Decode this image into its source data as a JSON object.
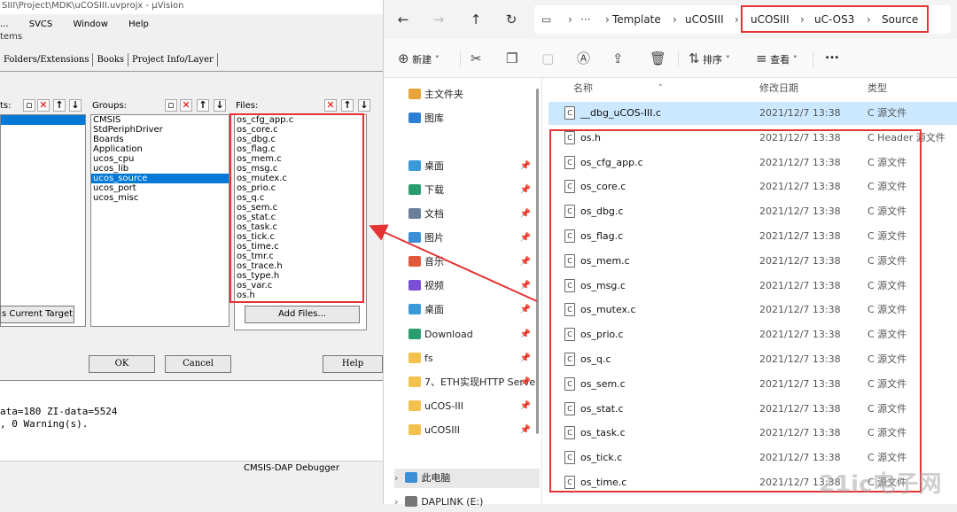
{
  "uvision": {
    "title": "SIII\\Project\\MDK\\uCOSIII.uvprojx - µVision",
    "menu": [
      "...",
      "SVCS",
      "Window",
      "Help"
    ],
    "dialog_title": "tems",
    "tabs": [
      "Folders/Extensions",
      "Books",
      "Project Info/Layer"
    ],
    "groups_label": "Groups:",
    "files_label": "Files:",
    "left_label": "ts:",
    "groups": [
      "CMSIS",
      "StdPeriphDriver",
      "Boards",
      "Application",
      "ucos_cpu",
      "ucos_lib",
      "ucos_source",
      "ucos_port",
      "ucos_misc"
    ],
    "selected_group": "ucos_source",
    "files": [
      "os_cfg_app.c",
      "os_core.c",
      "os_dbg.c",
      "os_flag.c",
      "os_mem.c",
      "os_msg.c",
      "os_mutex.c",
      "os_prio.c",
      "os_q.c",
      "os_sem.c",
      "os_stat.c",
      "os_task.c",
      "os_tick.c",
      "os_time.c",
      "os_tmr.c",
      "os_trace.h",
      "os_type.h",
      "os_var.c",
      "os.h"
    ],
    "set_target_button": "s Current Target",
    "add_files_button": "Add Files...",
    "ok_button": "OK",
    "cancel_button": "Cancel",
    "help_button": "Help",
    "build_output": [
      "ata=180 ZI-data=5524",
      ", 0 Warning(s)."
    ],
    "debugger": "CMSIS-DAP Debugger"
  },
  "explorer": {
    "breadcrumb": [
      "Template",
      "uCOSIII",
      "uCOSIII",
      "uC-OS3",
      "Source"
    ],
    "commands": {
      "new": "新建",
      "sort": "排序",
      "view": "查看",
      "more": "..."
    },
    "nav_items": [
      {
        "label": "主文件夹",
        "icon": "home-icon",
        "color": "#e8a33b"
      },
      {
        "label": "图库",
        "icon": "gallery-icon",
        "color": "#2c7fd1"
      },
      {
        "label": "桌面",
        "icon": "desktop-icon",
        "color": "#3a9ad9"
      },
      {
        "label": "下载",
        "icon": "download-icon",
        "color": "#2a9d6f"
      },
      {
        "label": "文档",
        "icon": "document-icon",
        "color": "#6a7f9a"
      },
      {
        "label": "图片",
        "icon": "picture-icon",
        "color": "#3a8fd6"
      },
      {
        "label": "音乐",
        "icon": "music-icon",
        "color": "#e05a3a"
      },
      {
        "label": "视频",
        "icon": "video-icon",
        "color": "#7b4fd6"
      },
      {
        "label": "桌面",
        "icon": "desktop-icon",
        "color": "#3a9ad9"
      },
      {
        "label": "Download",
        "icon": "download-icon",
        "color": "#2a9d6f"
      },
      {
        "label": "fs",
        "icon": "folder-icon",
        "color": "#f2c14e"
      },
      {
        "label": "7、ETH实现HTTP Serve",
        "icon": "folder-icon",
        "color": "#f2c14e"
      },
      {
        "label": "uCOS-III",
        "icon": "folder-icon",
        "color": "#f2c14e"
      },
      {
        "label": "uCOSIII",
        "icon": "folder-icon",
        "color": "#f2c14e"
      },
      {
        "label": "此电脑",
        "icon": "computer-icon",
        "color": "#3a8fd6"
      },
      {
        "label": "DAPLINK (E:)",
        "icon": "drive-icon",
        "color": "#777777"
      }
    ],
    "columns": {
      "name": "名称",
      "date": "修改日期",
      "type": "类型"
    },
    "files": [
      {
        "name": "__dbg_uCOS-III.c",
        "date": "2021/12/7 13:38",
        "type": "C 源文件"
      },
      {
        "name": "os.h",
        "date": "2021/12/7 13:38",
        "type": "C Header 源文件"
      },
      {
        "name": "os_cfg_app.c",
        "date": "2021/12/7 13:38",
        "type": "C 源文件"
      },
      {
        "name": "os_core.c",
        "date": "2021/12/7 13:38",
        "type": "C 源文件"
      },
      {
        "name": "os_dbg.c",
        "date": "2021/12/7 13:38",
        "type": "C 源文件"
      },
      {
        "name": "os_flag.c",
        "date": "2021/12/7 13:38",
        "type": "C 源文件"
      },
      {
        "name": "os_mem.c",
        "date": "2021/12/7 13:38",
        "type": "C 源文件"
      },
      {
        "name": "os_msg.c",
        "date": "2021/12/7 13:38",
        "type": "C 源文件"
      },
      {
        "name": "os_mutex.c",
        "date": "2021/12/7 13:38",
        "type": "C 源文件"
      },
      {
        "name": "os_prio.c",
        "date": "2021/12/7 13:38",
        "type": "C 源文件"
      },
      {
        "name": "os_q.c",
        "date": "2021/12/7 13:38",
        "type": "C 源文件"
      },
      {
        "name": "os_sem.c",
        "date": "2021/12/7 13:38",
        "type": "C 源文件"
      },
      {
        "name": "os_stat.c",
        "date": "2021/12/7 13:38",
        "type": "C 源文件"
      },
      {
        "name": "os_task.c",
        "date": "2021/12/7 13:38",
        "type": "C 源文件"
      },
      {
        "name": "os_tick.c",
        "date": "2021/12/7 13:38",
        "type": "C 源文件"
      },
      {
        "name": "os_time.c",
        "date": "2021/12/7 13:38",
        "type": "C 源文件"
      }
    ],
    "file_icon_glyph": "C",
    "watermark": "21ic电子网",
    "annotation_color": "#e33333"
  }
}
